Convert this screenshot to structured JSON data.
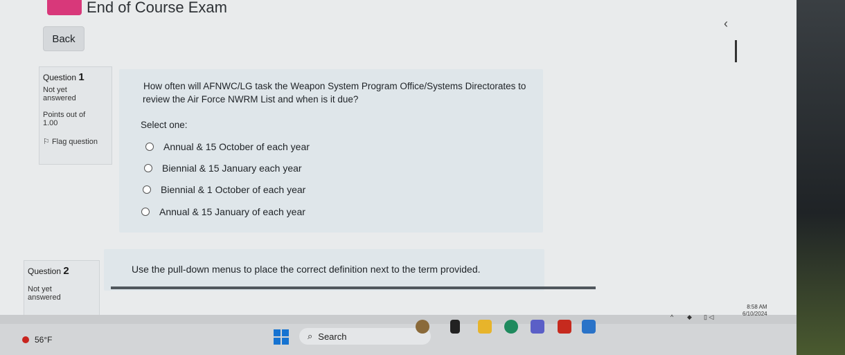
{
  "page": {
    "title": "End of Course Exam",
    "back_label": "Back"
  },
  "questions": [
    {
      "label": "Question",
      "number": "1",
      "status_line1": "Not yet",
      "status_line2": "answered",
      "points_line1": "Points out of",
      "points_line2": "1.00",
      "flag_label": "Flag question",
      "text_line1": "How often will AFNWC/LG task the Weapon System Program Office/Systems Directorates to",
      "text_line2": "review the Air Force NWRM List and when is it due?",
      "prompt": "Select one:",
      "options": [
        "Annual & 15 October of each year",
        "Biennial & 15 January each year",
        "Biennial & 1 October of each year",
        "Annual & 15 January of each year"
      ]
    },
    {
      "label": "Question",
      "number": "2",
      "status_line1": "Not yet",
      "status_line2": "answered",
      "text_line1": "Use the pull-down menus to place the correct definition next to the term provided."
    }
  ],
  "taskbar": {
    "weather_temp": "56°F",
    "search_label": "Search",
    "time": "8:58 AM",
    "date": "6/10/2024"
  },
  "icons": [
    "exam-icon",
    "collapse-chevron-icon",
    "flag-icon",
    "search-icon",
    "windows-start-icon",
    "weather-alert-icon"
  ]
}
